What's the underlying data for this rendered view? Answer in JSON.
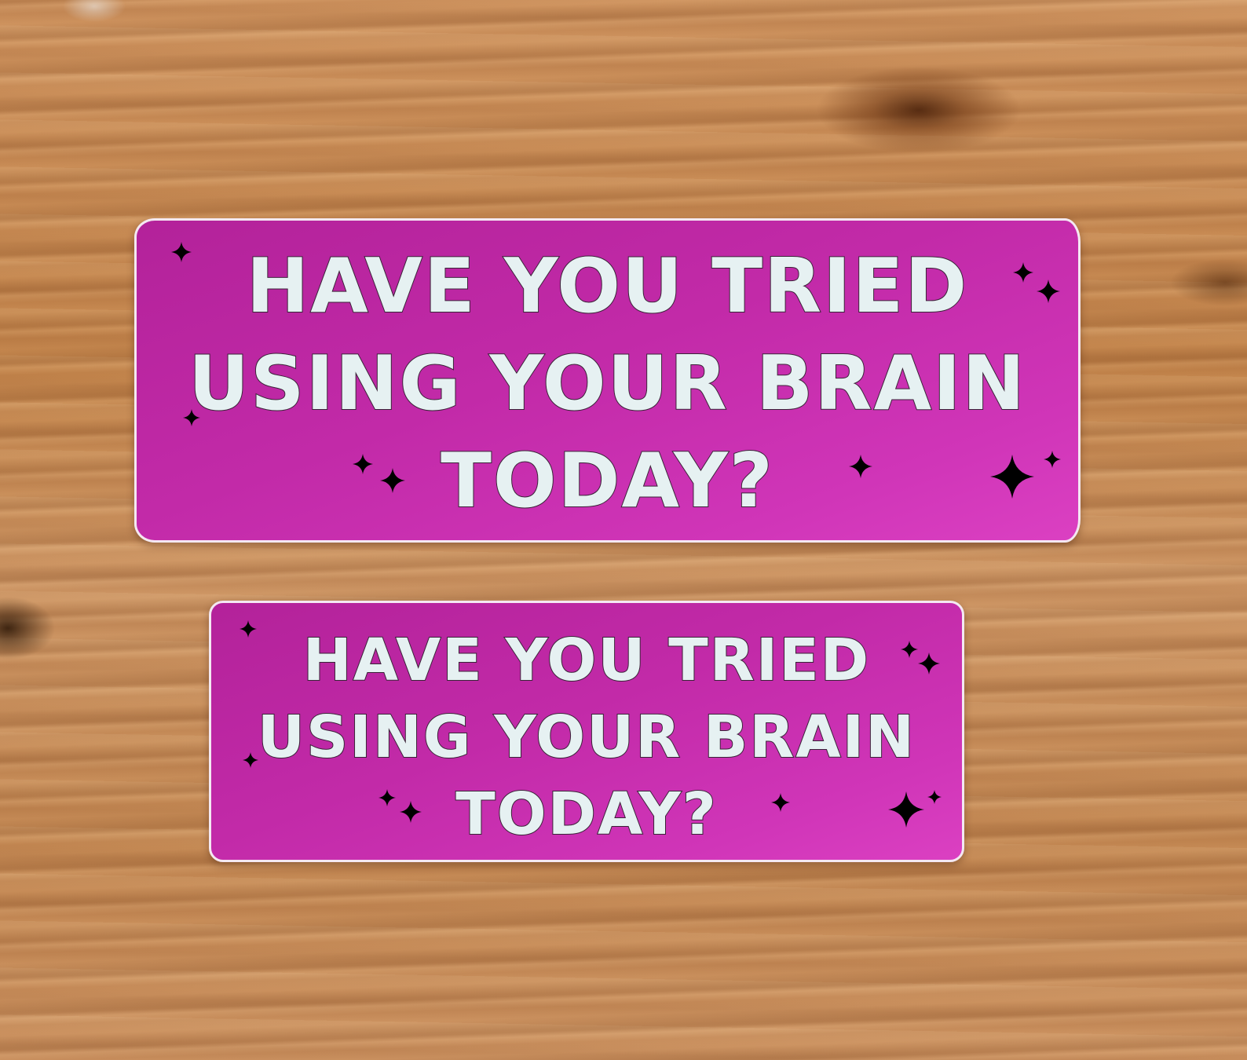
{
  "stickers": [
    {
      "size": "large",
      "lines": [
        "HAVE YOU TRIED",
        "USING YOUR BRAIN",
        "TODAY?"
      ],
      "background_color": "#c22aa8",
      "text_color": "#e6f1f2"
    },
    {
      "size": "small",
      "lines": [
        "HAVE YOU TRIED",
        "USING YOUR BRAIN",
        "TODAY?"
      ],
      "background_color": "#c22aa8",
      "text_color": "#e6f1f2"
    }
  ],
  "decorations": {
    "sparkle_icon": "four-point-star"
  },
  "surface": {
    "material": "wood",
    "color": "#c7874e"
  }
}
